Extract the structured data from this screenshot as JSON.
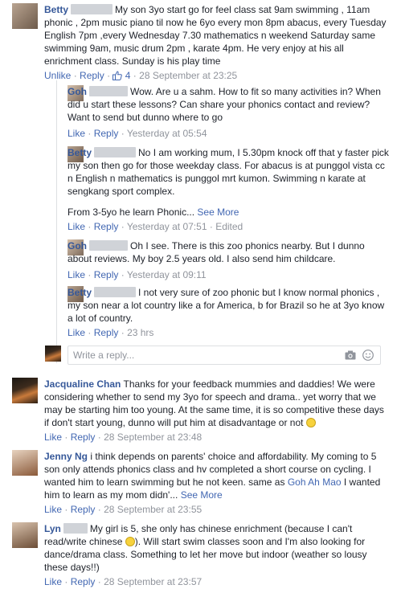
{
  "comments": [
    {
      "name": "Betty",
      "text": "My son 3yo start go for feel class sat 9am swimming , 11am phonic , 2pm music piano til now he 6yo every mon 8pm abacus, every Tuesday English 7pm ,every Wednesday 7.30 mathematics n weekend Saturday same swimming 9am, music drum 2pm , karate 4pm. He very enjoy at his all enrichment class. Sunday is his play time",
      "actions": {
        "unlike": "Unlike",
        "reply": "Reply",
        "like_count": "4",
        "time": "28 September at 23:25"
      },
      "replies": [
        {
          "name": "Goh",
          "text": "Wow. Are u a sahm. How to fit so many activities in? When did u start these lessons? Can share your phonics contact and review? Want to send but dunno where to go",
          "actions": {
            "like": "Like",
            "reply": "Reply",
            "time": "Yesterday at 05:54"
          }
        },
        {
          "name": "Betty",
          "text": "No I am working mum, I 5.30pm knock off that y faster pick my son then go for those weekday class. For abacus is at punggol vista cc n English n mathematics is punggol mrt kumon. Swimming n karate at sengkang sport complex.",
          "text2": "From 3-5yo he learn Phonic...",
          "see_more": "See More",
          "actions": {
            "like": "Like",
            "reply": "Reply",
            "time": "Yesterday at 07:51",
            "edited": "Edited"
          }
        },
        {
          "name": "Goh",
          "text": "Oh I see. There is this zoo phonics nearby. But I dunno about reviews. My boy 2.5 years old. I also send him childcare.",
          "actions": {
            "like": "Like",
            "reply": "Reply",
            "time": "Yesterday at 09:11"
          }
        },
        {
          "name": "Betty",
          "text": "I not very sure of zoo phonic but I know normal phonics , my son near a lot country like a for America, b for Brazil so he at 3yo know a lot of country.",
          "actions": {
            "like": "Like",
            "reply": "Reply",
            "time": "23 hrs"
          }
        }
      ],
      "write_reply_placeholder": "Write a reply..."
    },
    {
      "name": "Jacqualine Chan",
      "text": "Thanks for your feedback mummies and daddies! We were considering whether to send my 3yo for speech and drama.. yet worry that we may be starting him too young. At the same time, it is so competitive these days if don't start young, dunno will put him at disadvantage or not",
      "actions": {
        "like": "Like",
        "reply": "Reply",
        "time": "28 September at 23:48"
      }
    },
    {
      "name": "Jenny Ng",
      "text": "i think depends on parents' choice and affordability. My coming to 5 son only attends phonics class and hv completed a short course on cycling. I wanted him to learn swimming but he not keen. same as",
      "mention": "Goh Ah Mao",
      "text_after": "I wanted him to learn as my mom didn'...",
      "see_more": "See More",
      "actions": {
        "like": "Like",
        "reply": "Reply",
        "time": "28 September at 23:55"
      }
    },
    {
      "name": "Lyn",
      "text": "My girl is 5, she only has chinese enrichment (because I can't read/write chinese",
      "text_after": "). Will start swim classes soon and I'm also looking for dance/drama class. Something to let her move but indoor (weather so lousy these days!!)",
      "actions": {
        "like": "Like",
        "reply": "Reply",
        "time": "28 September at 23:57"
      }
    }
  ],
  "icons": {
    "camera": "camera-icon",
    "emoji": "emoji-icon",
    "like": "like-thumb-icon"
  },
  "colors": {
    "link": "#365899",
    "meta": "#90949c",
    "action": "#4267b2"
  }
}
